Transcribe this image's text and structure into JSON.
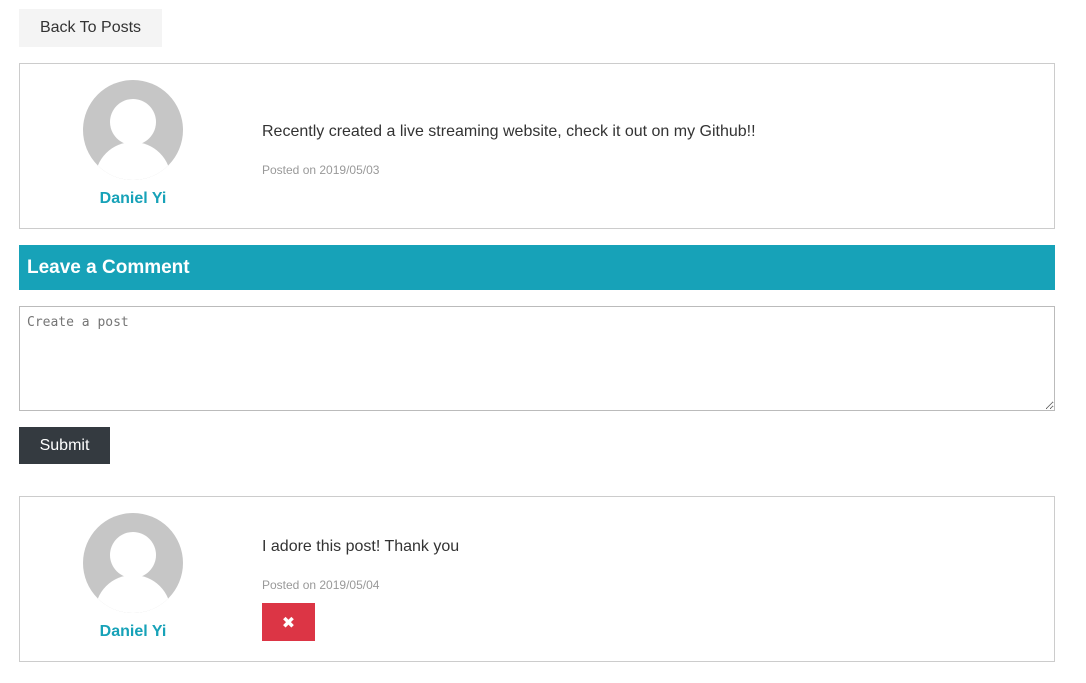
{
  "nav": {
    "back_label": "Back To Posts"
  },
  "post": {
    "author": "Daniel Yi",
    "text": "Recently created a live streaming website, check it out on my Github!!",
    "date": "Posted on 2019/05/03"
  },
  "comment_form": {
    "header": "Leave a Comment",
    "placeholder": "Create a post",
    "submit_label": "Submit"
  },
  "comments": [
    {
      "author": "Daniel Yi",
      "text": "I adore this post! Thank you",
      "date": "Posted on 2019/05/04",
      "delete_icon": "close-icon",
      "delete_glyph": "✖"
    }
  ],
  "colors": {
    "accent": "#17a2b8",
    "danger": "#dc3545",
    "dark": "#343a40",
    "avatar_bg": "#c6c6c6"
  }
}
